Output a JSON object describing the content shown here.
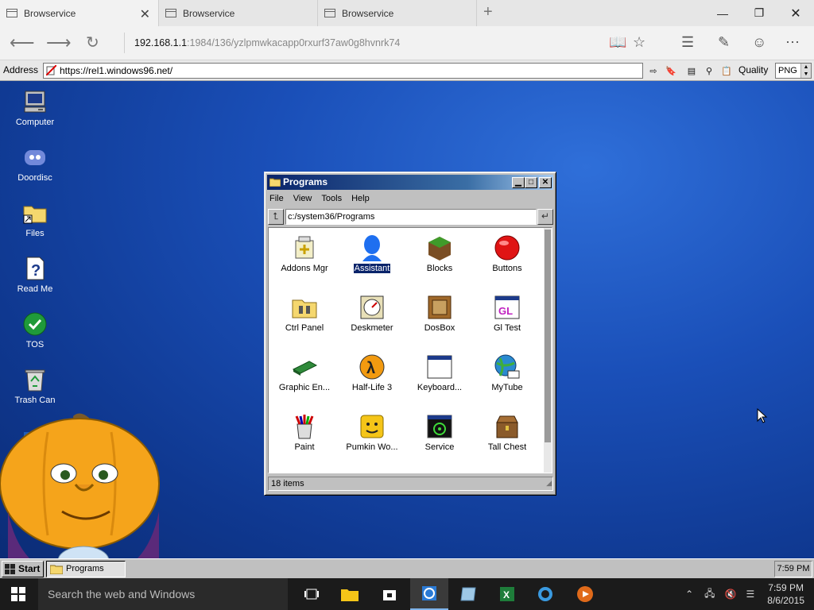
{
  "browser": {
    "tabs": [
      {
        "label": "Browservice",
        "active": true
      },
      {
        "label": "Browservice",
        "active": false
      },
      {
        "label": "Browservice",
        "active": false
      }
    ],
    "url_host": "192.168.1.1",
    "url_rest": ":1984/136/yzlpmwkacapp0rxurf37aw0g8hvnrk74"
  },
  "browservice": {
    "address_label": "Address",
    "address_value": "https://rel1.windows96.net/",
    "quality_label": "Quality",
    "quality_value": "PNG"
  },
  "desktop": {
    "icons": [
      {
        "label": "Computer",
        "icon": "computer-icon"
      },
      {
        "label": "Doordisc",
        "icon": "discord-icon"
      },
      {
        "label": "Files",
        "icon": "folder-shortcut-icon"
      },
      {
        "label": "Read Me",
        "icon": "help-document-icon"
      },
      {
        "label": "TOS",
        "icon": "checkmark-icon"
      },
      {
        "label": "Trash Can",
        "icon": "recycle-bin-icon"
      }
    ]
  },
  "window": {
    "title": "Programs",
    "menu": [
      "File",
      "View",
      "Tools",
      "Help"
    ],
    "path": "c:/system36/Programs",
    "status": "18 items",
    "items": [
      {
        "label": "Addons Mgr",
        "icon": "addons-icon"
      },
      {
        "label": "Assistant",
        "icon": "assistant-icon",
        "selected": true
      },
      {
        "label": "Blocks",
        "icon": "blocks-icon"
      },
      {
        "label": "Buttons",
        "icon": "red-button-icon"
      },
      {
        "label": "Ctrl Panel",
        "icon": "control-panel-icon"
      },
      {
        "label": "Deskmeter",
        "icon": "deskmeter-icon"
      },
      {
        "label": "DosBox",
        "icon": "dosbox-icon"
      },
      {
        "label": "Gl Test",
        "icon": "gl-test-icon"
      },
      {
        "label": "Graphic En...",
        "icon": "graphics-card-icon"
      },
      {
        "label": "Half-Life 3",
        "icon": "half-life-icon"
      },
      {
        "label": "Keyboard...",
        "icon": "keyboard-window-icon"
      },
      {
        "label": "MyTube",
        "icon": "mytube-icon"
      },
      {
        "label": "Paint",
        "icon": "paint-icon"
      },
      {
        "label": "Pumkin Wo...",
        "icon": "pumpkin-face-icon"
      },
      {
        "label": "Service",
        "icon": "service-icon"
      },
      {
        "label": "Tall Chest",
        "icon": "chest-icon"
      }
    ]
  },
  "w96_taskbar": {
    "start_label": "Start",
    "task_label": "Programs",
    "clock": "7:59 PM"
  },
  "w10_taskbar": {
    "search_placeholder": "Search the web and Windows",
    "time": "7:59 PM",
    "date": "8/6/2015"
  },
  "colors": {
    "desktop_blue": "#1a4fb8",
    "titlebar_start": "#0a246a",
    "win96_gray": "#c0c0c0"
  }
}
